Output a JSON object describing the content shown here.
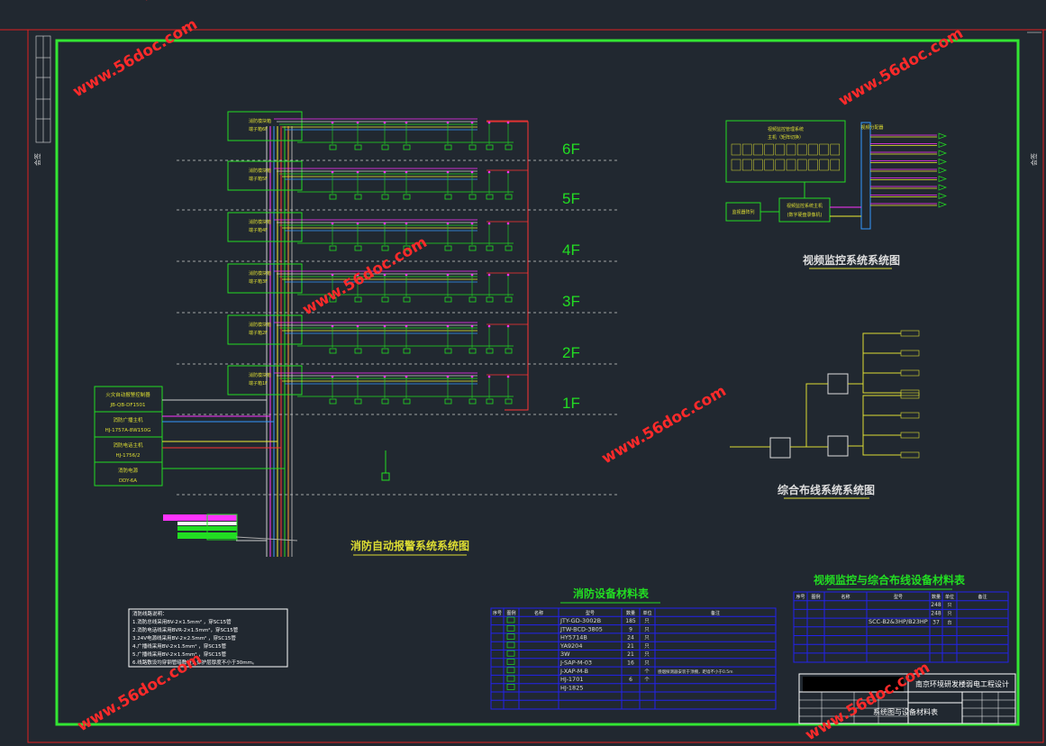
{
  "floors": [
    "6F",
    "5F",
    "4F",
    "3F",
    "2F",
    "1F"
  ],
  "panel_boxes": [
    {
      "line1": "火灾自动报警控制器",
      "line2": "JB-QB-DF1501"
    },
    {
      "line1": "消防广播主机",
      "line2": "HJ-1757A-8W150G"
    },
    {
      "line1": "消防电话主机",
      "line2": "HJ-1756/2"
    },
    {
      "line1": "消防电源",
      "line2": "DDY-6A"
    }
  ],
  "titles": {
    "fire_system": "消防自动报警系统系统图",
    "video_system": "视频监控系统系统图",
    "cabling_system": "综合布线系统系统图",
    "fire_table": "消防设备材料表",
    "video_table": "视频监控与综合布线设备材料表"
  },
  "fire_table": {
    "headers": [
      "序号",
      "图例",
      "名称",
      "型号",
      "数量",
      "单位",
      "备注"
    ],
    "models": [
      "JTY-GD-3002B",
      "JTW-BCD-3805",
      "HY5714B",
      "YA9204",
      "3W",
      "J-SAP-M-03",
      "J-XAP-M-B",
      "HJ-1701",
      "HJ-1825"
    ],
    "counts": [
      "185",
      "9",
      "24",
      "21",
      "21",
      "16",
      "",
      "6",
      ""
    ],
    "units": [
      "只",
      "只",
      "只",
      "只",
      "只",
      "只",
      "个",
      "个",
      ""
    ],
    "note": "感烟探测器安装于顶棚，距墙不小于0.5m"
  },
  "video_table": {
    "headers": [
      "序号",
      "图例",
      "名称",
      "型号",
      "数量",
      "单位",
      "备注"
    ],
    "model": "SCC-B2&3HP/B23HP",
    "counts": [
      "248",
      "248",
      "37"
    ],
    "units": [
      "只",
      "只",
      "台"
    ]
  },
  "notes_title": "消防线路说明：",
  "notes": [
    "1.消防总线采用BV-2×1.5mm² ，穿SC15管",
    "2.消防电话线采用BVR-2×1.5mm²，穿SC15管",
    "3.24V电源线采用BV-2×2.5mm² ，穿SC15管",
    "4.广播线采用BV-2×1.5mm² ，穿SC15管",
    "5.广播线采用BV-2×1.5mm² ，穿SC15管",
    "6.线路敷设均穿钢管暗敷设，保护层厚度不小于30mm。"
  ],
  "title_block": {
    "project": "南京环境研发楼弱电工程设计",
    "drawing": "系统图与设备材料表"
  },
  "watermark": "www.56doc.com",
  "colors": {
    "background": "#212830",
    "frame": "#33e633",
    "outer_frame": "#e02020",
    "device_green": "#22dd22",
    "table_blue": "#2222ee"
  }
}
